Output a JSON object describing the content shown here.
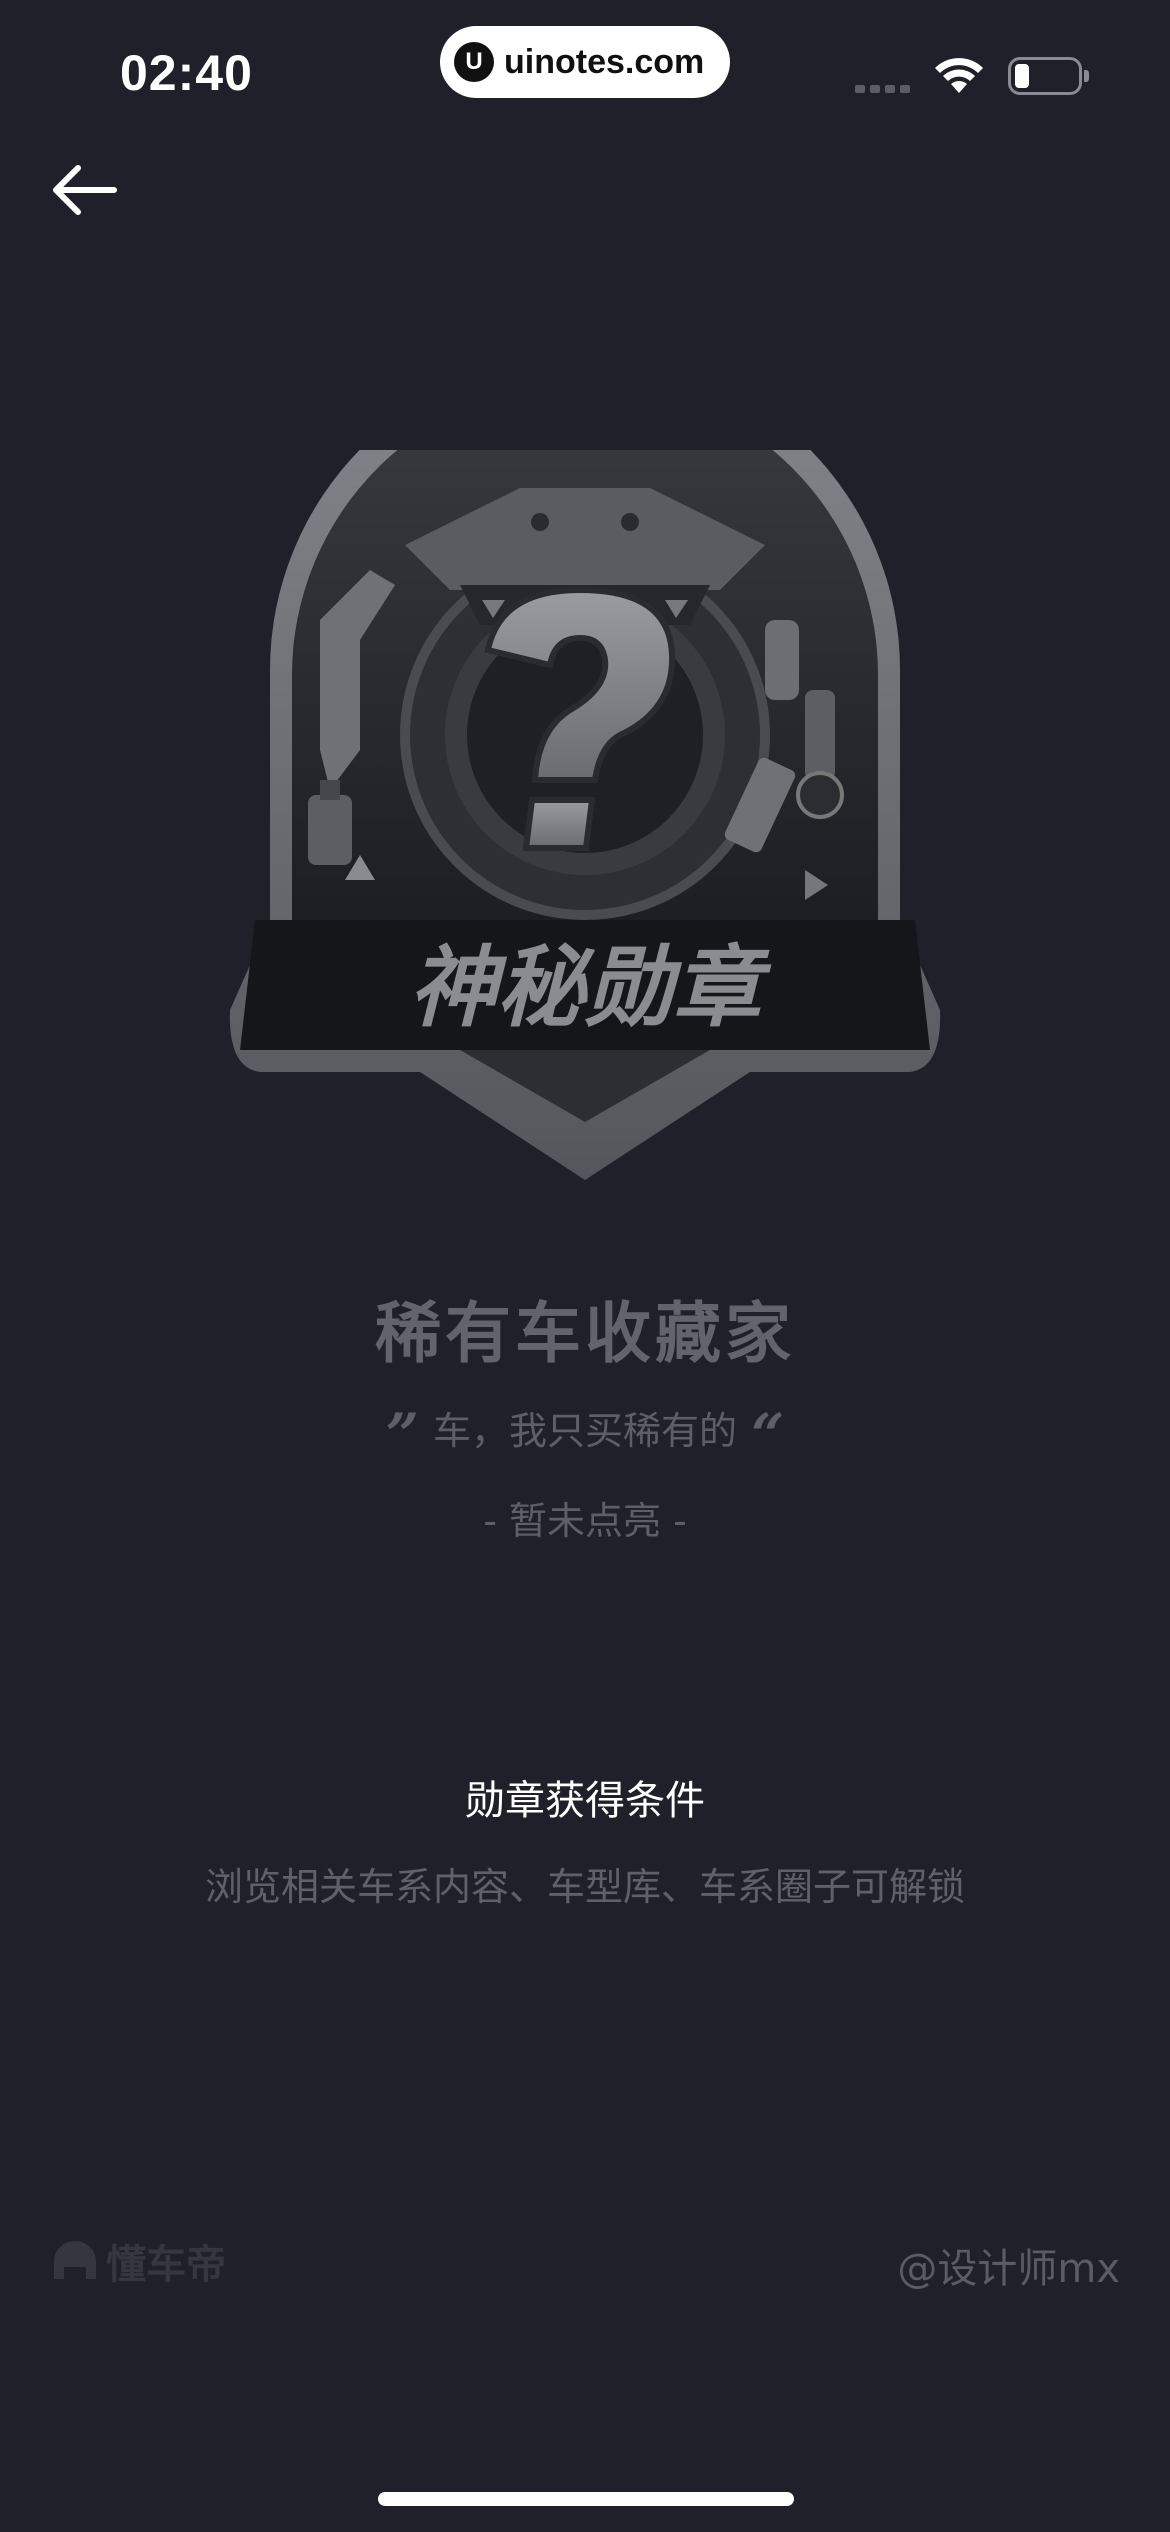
{
  "status_bar": {
    "time": "02:40",
    "url": "uinotes.com",
    "logo_glyph": "U"
  },
  "badge": {
    "ribbon_text": "神秘勋章",
    "center_glyph": "?"
  },
  "medal_info": {
    "name": "稀有车收藏家",
    "quote": "车，我只买稀有的",
    "quote_open": "”",
    "quote_close": "“",
    "status": "- 暂未点亮 -"
  },
  "condition": {
    "title": "勋章获得条件",
    "description": "浏览相关车系内容、车型库、车系圈子可解锁"
  },
  "footer": {
    "brand": "懂车帝",
    "credit": "@设计师mx"
  },
  "colors": {
    "background": "#1f2029",
    "muted_text": "#5d5e66",
    "badge_rim": "#6e6f75"
  }
}
